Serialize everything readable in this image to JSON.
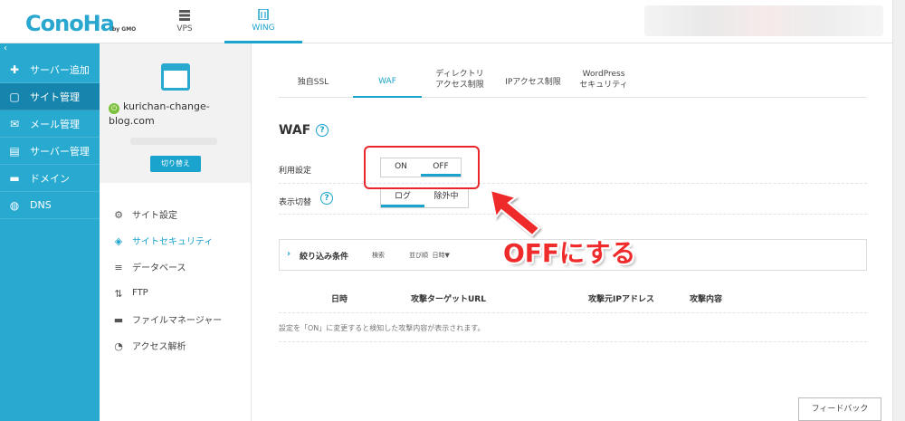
{
  "topbar": {
    "logo_text": "ConoHa",
    "logo_sub": "by GMO",
    "nav": [
      {
        "label": "VPS",
        "icon": "server-icon"
      },
      {
        "label": "WING",
        "icon": "building-icon"
      }
    ]
  },
  "sidebar": {
    "collapse_glyph": "‹",
    "items": [
      {
        "label": "サーバー追加",
        "glyph": "✚",
        "icon": "plus-icon"
      },
      {
        "label": "サイト管理",
        "glyph": "▢",
        "icon": "window-icon"
      },
      {
        "label": "メール管理",
        "glyph": "✉",
        "icon": "mail-icon"
      },
      {
        "label": "サーバー管理",
        "glyph": "▤",
        "icon": "server-stack-icon"
      },
      {
        "label": "ドメイン",
        "glyph": "▬",
        "icon": "domain-icon"
      },
      {
        "label": "DNS",
        "glyph": "◍",
        "icon": "globe-icon"
      }
    ]
  },
  "site": {
    "domain": "kurichan-change-blog.com",
    "switch_label": "切り替え",
    "menu": [
      {
        "label": "サイト設定",
        "glyph": "⚙",
        "icon": "site-settings-icon"
      },
      {
        "label": "サイトセキュリティ",
        "glyph": "◈",
        "icon": "shield-icon"
      },
      {
        "label": "データベース",
        "glyph": "≡",
        "icon": "database-icon"
      },
      {
        "label": "FTP",
        "glyph": "⇅",
        "icon": "ftp-icon"
      },
      {
        "label": "ファイルマネージャー",
        "glyph": "▬",
        "icon": "folder-icon"
      },
      {
        "label": "アクセス解析",
        "glyph": "◔",
        "icon": "pie-chart-icon"
      }
    ]
  },
  "tabs": [
    {
      "label": "独自SSL"
    },
    {
      "label": "WAF"
    },
    {
      "label": "ディレクトリ\nアクセス制限"
    },
    {
      "label": "IPアクセス制限"
    },
    {
      "label": "WordPress\nセキュリティ"
    }
  ],
  "waf": {
    "title": "WAF",
    "help_glyph": "?",
    "usage_label": "利用設定",
    "usage_on": "ON",
    "usage_off": "OFF",
    "display_label": "表示切替",
    "display_log": "ログ",
    "display_excluded": "除外中",
    "filter_chevron": "›",
    "filter_label": "絞り込み条件",
    "filter_search": "検索",
    "filter_sort": "並び順",
    "filter_sort_value": "日時▼",
    "columns": [
      "日時",
      "攻撃ターゲットURL",
      "攻撃元IPアドレス",
      "攻撃内容"
    ],
    "empty_message": "設定を「ON」に変更すると検知した攻撃内容が表示されます。"
  },
  "feedback_label": "フィードバック",
  "annotation": {
    "text": "OFFにする",
    "color": "#ef2b2b"
  },
  "colors": {
    "accent": "#1aa3cc",
    "sidebar": "#27a9d0",
    "sidebar_active": "#1585ad",
    "highlight": "#e8262b"
  }
}
